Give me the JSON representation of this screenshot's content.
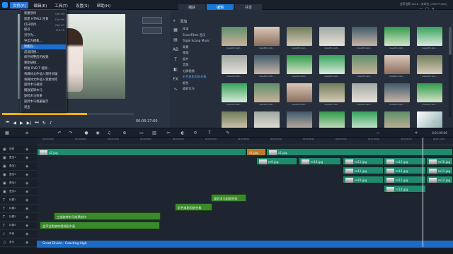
{
  "menubar": {
    "items": [
      "文件(F)",
      "编辑(E)",
      "工具(T)",
      "设置(S)",
      "帮助(H)"
    ],
    "active_index": 0
  },
  "steps": [
    "捕获",
    "编辑",
    "共享"
  ],
  "steps_active": 1,
  "title_right": "会声会影 2018 - 未命名 [1920*1080]",
  "file_menu": {
    "items": [
      {
        "label": "新建项目",
        "shortcut": "Ctrl+N"
      },
      {
        "label": "新建 HTML5 项目",
        "shortcut": "Ctrl+M"
      },
      {
        "label": "打开项目...",
        "shortcut": "Ctrl+O"
      },
      {
        "label": "保存",
        "shortcut": "Ctrl+S"
      },
      {
        "label": "另存为...",
        "shortcut": ""
      },
      {
        "label": "导出为模板...",
        "shortcut": ""
      },
      {
        "label": "智能包...",
        "shortcut": ""
      },
      {
        "label": "成批转换...",
        "shortcut": ""
      },
      {
        "label": "保存修整后的视频",
        "shortcut": ""
      },
      {
        "label": "重新链接...",
        "shortcut": ""
      },
      {
        "label": "修复 DVB-T 视频...",
        "shortcut": ""
      },
      {
        "label": "将媒体文件插入到时间轴",
        "shortcut": ""
      },
      {
        "label": "将媒体文件插入到素材库",
        "shortcut": ""
      },
      {
        "label": "旋转木马视频",
        "shortcut": ""
      },
      {
        "label": "播放旋转木马",
        "shortcut": ""
      },
      {
        "label": "旋转木马效果",
        "shortcut": ""
      },
      {
        "label": "旋转木马相册展示",
        "shortcut": ""
      },
      {
        "label": "退出",
        "shortcut": ""
      }
    ],
    "selected_index": 6
  },
  "player": {
    "timecode": "00:00:27:00"
  },
  "library": {
    "add_label": "添加",
    "tree": [
      "样本",
      "ScoreFitter 音乐",
      "Triple Scoop Music",
      "背景",
      "视频",
      "照片",
      "音频",
      "分屏视频",
      "彩色电影相册合集",
      "颜色",
      "旋转木马"
    ],
    "tree_selected": 8,
    "thumb_caption": "beautiful-ladi...",
    "bottom_label": "浏览"
  },
  "ruler": [
    "00:00:00:00",
    "00:00:06:00",
    "00:00:12:00",
    "00:00:18:00",
    "00:00:24:00",
    "00:00:30:00",
    "00:00:36:00",
    "00:00:42:00",
    "00:00:48:00",
    "00:00:54:00",
    "00:01:00:00",
    "00:01:06:00",
    "00:01:12:00"
  ],
  "tracks": [
    {
      "icon": "▣",
      "label": "视频"
    },
    {
      "icon": "▣",
      "label": "叠加1"
    },
    {
      "icon": "▣",
      "label": "叠加2"
    },
    {
      "icon": "▣",
      "label": "叠加3"
    },
    {
      "icon": "▣",
      "label": "叠加4"
    },
    {
      "icon": "▣",
      "label": "叠加5"
    },
    {
      "icon": "T",
      "label": "标题1"
    },
    {
      "icon": "T",
      "label": "标题2"
    },
    {
      "icon": "T",
      "label": "标题3"
    },
    {
      "icon": "T",
      "label": "标题4"
    },
    {
      "icon": "♪",
      "label": "声音"
    },
    {
      "icon": "♫",
      "label": "音乐"
    }
  ],
  "clips": {
    "video1": "s2.jpg",
    "video2": "s1.jpg",
    "ov_a": "m9.jpg",
    "ov_b": "m10.jpg",
    "ov_c": "m11.jpg",
    "ov_d": "m12.jpg",
    "ov_e": "m10.jpg",
    "ov_f": "m11.jpg",
    "ov_g": "m12.jpg",
    "title1": "旋转木马相册特效",
    "title2": "彩色电影相册合集",
    "title3": "三维旋转木马效果制作",
    "title4": "会声会影旋转视频画中画"
  },
  "audio_clip": "Great Divide - Coasting High",
  "colors": {
    "accent": "#1679d8",
    "clip": "#1f8a6e",
    "title": "#3a8a2a",
    "audio": "#1c6bc4"
  }
}
